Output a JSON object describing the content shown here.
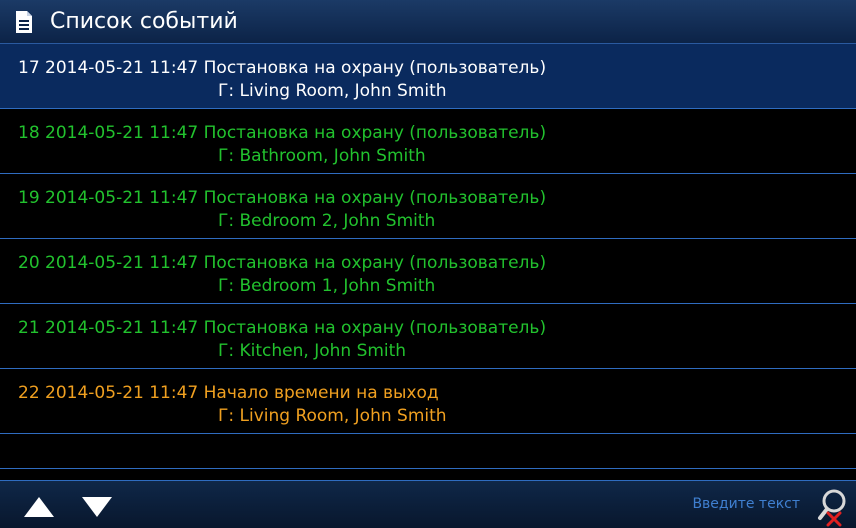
{
  "header": {
    "title": "Список событий",
    "icon": "document-icon"
  },
  "colors": {
    "selected_text": "#ffffff",
    "arm_event": "#22c22e",
    "exit_event": "#f0a020",
    "divider": "#2f6cc0",
    "header_bg": "#0c2347"
  },
  "events": [
    {
      "line1": "17 2014-05-21 11:47 Постановка на охрану (пользователь)",
      "line2": "Г: Living Room, John Smith"
    },
    {
      "line1": "18 2014-05-21 11:47 Постановка на охрану (пользователь)",
      "line2": "Г: Bathroom, John Smith"
    },
    {
      "line1": "19 2014-05-21 11:47 Постановка на охрану (пользователь)",
      "line2": "Г: Bedroom 2, John Smith"
    },
    {
      "line1": "20 2014-05-21 11:47 Постановка на охрану (пользователь)",
      "line2": "Г: Bedroom 1, John Smith"
    },
    {
      "line1": "21 2014-05-21 11:47 Постановка на охрану (пользователь)",
      "line2": "Г: Kitchen, John Smith"
    },
    {
      "line1": "22 2014-05-21 11:47 Начало времени на выход",
      "line2": "Г: Living Room, John Smith"
    }
  ],
  "footer": {
    "up_icon": "arrow-up-icon",
    "down_icon": "arrow-down-icon",
    "search_placeholder": "Введите текст",
    "search_icon": "search-clear-icon"
  }
}
